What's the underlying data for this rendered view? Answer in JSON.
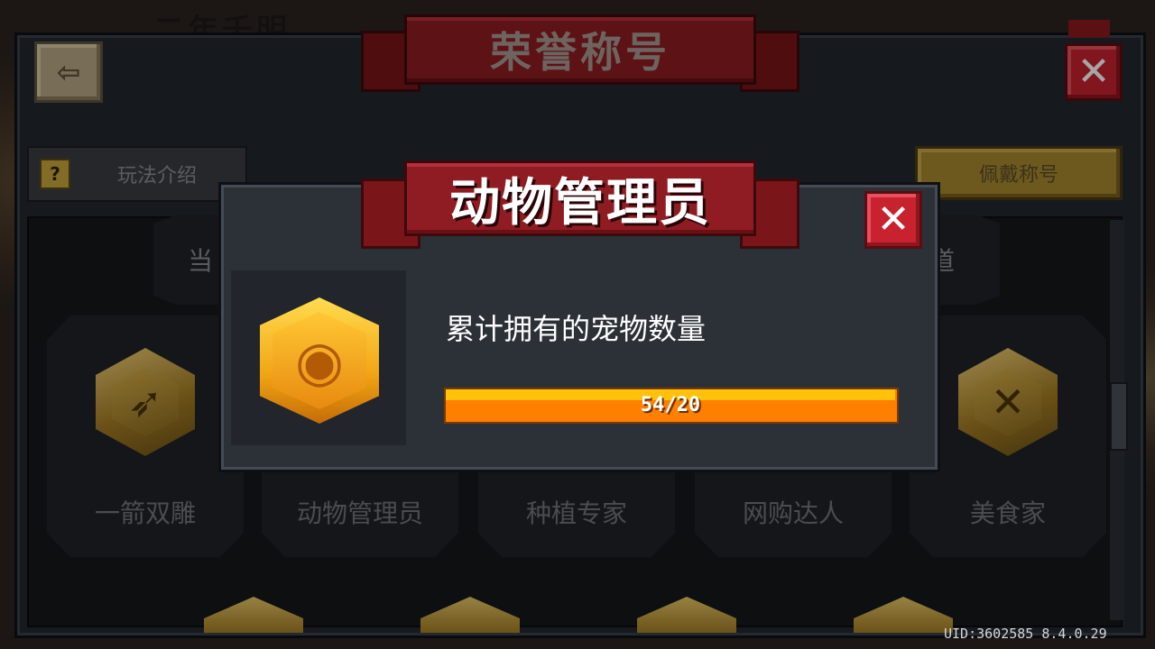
{
  "background": {
    "title_partial": "二年千明"
  },
  "header": {
    "title": "荣誉称号"
  },
  "toolbar": {
    "rules_label": "玩法介绍",
    "wear_label": "佩戴称号"
  },
  "partial_labels": {
    "left": "当",
    "right": "道"
  },
  "titles": [
    {
      "label": "一箭双雕",
      "icon": "bow-arrow-badge"
    },
    {
      "label": "动物管理员",
      "icon": "hamster-badge"
    },
    {
      "label": "种植专家",
      "icon": "plant-badge"
    },
    {
      "label": "网购达人",
      "icon": "cart-badge"
    },
    {
      "label": "美食家",
      "icon": "fork-knife-badge"
    }
  ],
  "dialog": {
    "title": "动物管理员",
    "description": "累计拥有的宠物数量",
    "progress_text": "54/20",
    "progress_fraction": 1.0,
    "icon": "hamster-badge"
  },
  "footer": {
    "uid": "UID:3602585 8.4.0.29"
  },
  "colors": {
    "accent_red": "#8f1c22",
    "close_red": "#c8222f",
    "gold": "#a8892e",
    "progress_orange": "#ff7f00",
    "progress_yellow": "#ffc10a"
  }
}
